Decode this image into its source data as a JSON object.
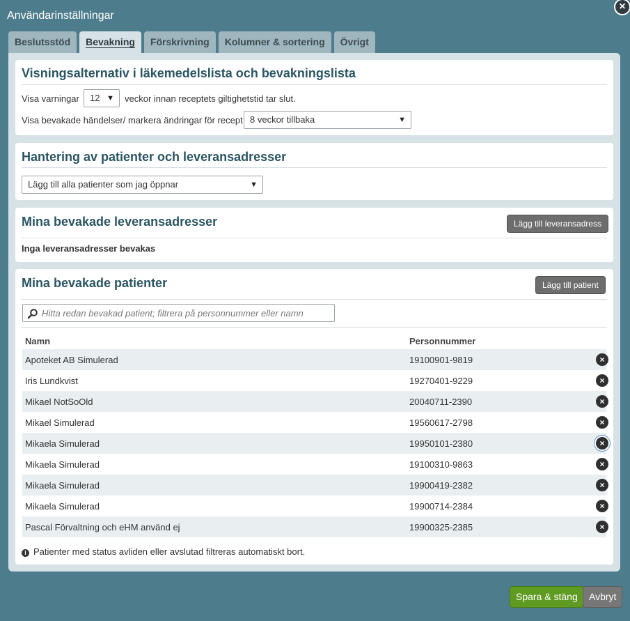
{
  "dialog": {
    "title": "Användarinställningar",
    "close_label": "×"
  },
  "tabs": [
    {
      "label": "Beslutsstöd",
      "active": false
    },
    {
      "label": "Bevakning",
      "active": true
    },
    {
      "label": "Förskrivning",
      "active": false
    },
    {
      "label": "Kolumner & sortering",
      "active": false
    },
    {
      "label": "Övrigt",
      "active": false
    }
  ],
  "display_options": {
    "heading": "Visningsalternativ i läkemedelslista och bevakningslista",
    "warnings_prefix": "Visa varningar",
    "warnings_value": "12",
    "warnings_suffix": "veckor innan receptets giltighetstid tar slut.",
    "events_label": "Visa bevakade händelser/ markera ändringar för recept",
    "events_value": "8 veckor tillbaka"
  },
  "patient_handling": {
    "heading": "Hantering av patienter och leveransadresser",
    "select_value": "Lägg till alla patienter som jag öppnar"
  },
  "addresses": {
    "heading": "Mina bevakade leveransadresser",
    "add_button": "Lägg till leveransadress",
    "empty_text": "Inga leveransadresser bevakas"
  },
  "patients": {
    "heading": "Mina bevakade patienter",
    "add_button": "Lägg till patient",
    "search_placeholder": "Hitta redan bevakad patient; filtrera på personnummer eller namn",
    "col_name": "Namn",
    "col_pnr": "Personnummer",
    "rows": [
      {
        "name": "Apoteket AB Simulerad",
        "pnr": "19100901-9819"
      },
      {
        "name": "Iris Lundkvist",
        "pnr": "19270401-9229"
      },
      {
        "name": "Mikael NotSoOld",
        "pnr": "20040711-2390"
      },
      {
        "name": "Mikael Simulerad",
        "pnr": "19560617-2798"
      },
      {
        "name": "Mikaela Simulerad",
        "pnr": "19950101-2380"
      },
      {
        "name": "Mikaela Simulerad",
        "pnr": "19100310-9863"
      },
      {
        "name": "Mikaela Simulerad",
        "pnr": "19900419-2382"
      },
      {
        "name": "Mikaela Simulerad",
        "pnr": "19900714-2384"
      },
      {
        "name": "Pascal Förvaltning och eHM använd ej",
        "pnr": "19900325-2385"
      }
    ],
    "info_text": "Patienter med status avliden eller avslutad filtreras automatiskt bort."
  },
  "footer": {
    "save_label": "Spara & stäng",
    "cancel_label": "Avbryt"
  },
  "colors": {
    "accent_green": "#5f9b22",
    "heading_blue": "#2a5563",
    "backdrop": "#4d7c8c"
  }
}
